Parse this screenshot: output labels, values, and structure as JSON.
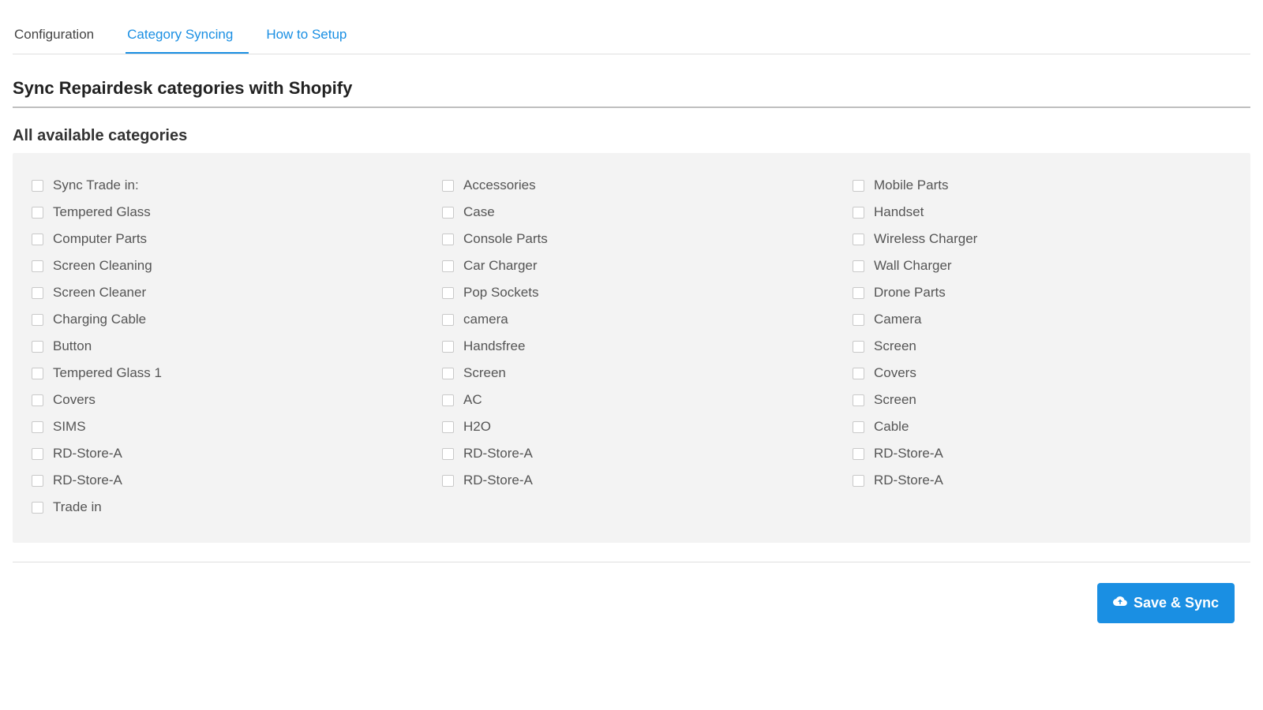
{
  "tabs": {
    "configuration": "Configuration",
    "category_syncing": "Category Syncing",
    "how_to_setup": "How to Setup",
    "active": "category_syncing"
  },
  "page_title": "Sync Repairdesk categories with Shopify",
  "sub_title": "All available categories",
  "columns": [
    [
      "Sync Trade in:",
      "Tempered Glass",
      "Computer Parts",
      "Screen Cleaning",
      "Screen Cleaner",
      "Charging Cable",
      "Button",
      "Tempered Glass 1",
      "Covers",
      "SIMS",
      "RD-Store-A",
      "RD-Store-A",
      "Trade in"
    ],
    [
      "Accessories",
      "Case",
      "Console Parts",
      "Car Charger",
      "Pop Sockets",
      "camera",
      "Handsfree",
      "Screen",
      "AC",
      "H2O",
      "RD-Store-A",
      "RD-Store-A"
    ],
    [
      "Mobile Parts",
      "Handset",
      "Wireless Charger",
      "Wall Charger",
      "Drone Parts",
      "Camera",
      "Screen",
      "Covers",
      "Screen",
      "Cable",
      "RD-Store-A",
      "RD-Store-A"
    ]
  ],
  "save_button": "Save & Sync"
}
